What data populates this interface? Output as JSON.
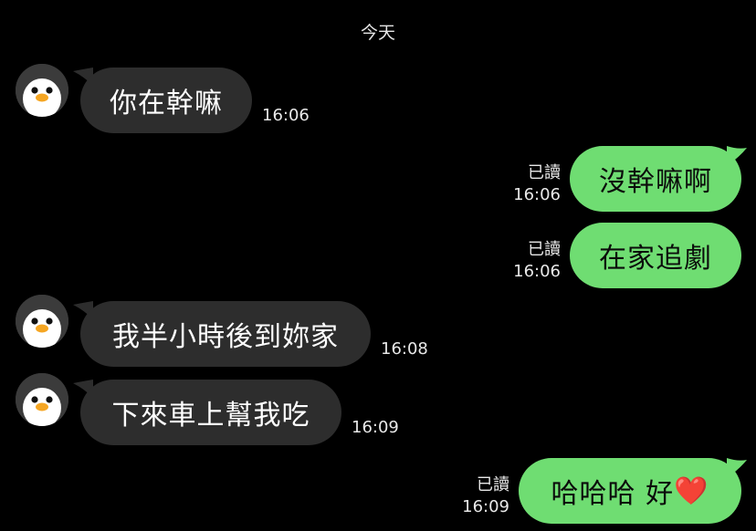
{
  "date_divider": "今天",
  "messages": [
    {
      "text": "你在幹嘛",
      "time": "16:06"
    },
    {
      "text": "沒幹嘛啊",
      "read": "已讀",
      "time": "16:06"
    },
    {
      "text": "在家追劇",
      "read": "已讀",
      "time": "16:06"
    },
    {
      "text": "我半小時後到妳家",
      "time": "16:08"
    },
    {
      "text": "下來車上幫我吃",
      "time": "16:09"
    },
    {
      "text": "哈哈哈 好",
      "emoji": "❤️",
      "read": "已讀",
      "time": "16:09"
    }
  ],
  "colors": {
    "background": "#000000",
    "incoming_bubble": "#2d2d2d",
    "outgoing_bubble": "#6fdd72",
    "avatar_bg": "#3b3b3b"
  },
  "avatar_icon": "penguin-icon"
}
